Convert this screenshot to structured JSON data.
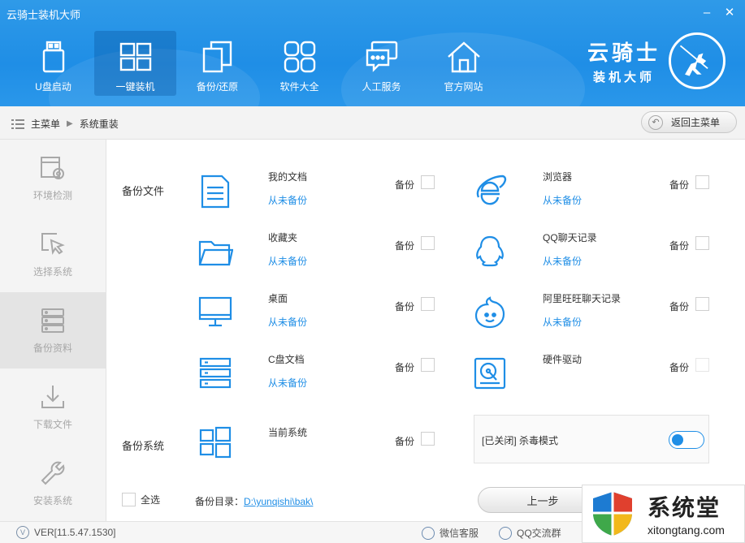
{
  "app": {
    "title": "云骑士装机大师"
  },
  "window": {
    "minimize": "–",
    "close": "✕"
  },
  "nav": [
    {
      "label": "U盘启动",
      "icon": "usb-drive-icon"
    },
    {
      "label": "一键装机",
      "icon": "windows-logo-icon",
      "active": true
    },
    {
      "label": "备份/还原",
      "icon": "backup-restore-icon"
    },
    {
      "label": "软件大全",
      "icon": "apps-grid-icon"
    },
    {
      "label": "人工服务",
      "icon": "chat-bubble-icon"
    },
    {
      "label": "官方网站",
      "icon": "home-icon"
    }
  ],
  "brand": {
    "line1": "云骑士",
    "line2": "装机大师"
  },
  "breadcrumb": {
    "root": "主菜单",
    "current": "系统重装"
  },
  "back_button": {
    "label": "返回主菜单"
  },
  "sidebar": [
    {
      "label": "环境检测",
      "icon": "environment-check-icon"
    },
    {
      "label": "选择系统",
      "icon": "cursor-select-icon"
    },
    {
      "label": "备份资料",
      "icon": "database-backup-icon",
      "active": true
    },
    {
      "label": "下载文件",
      "icon": "download-icon"
    },
    {
      "label": "安装系统",
      "icon": "wrench-icon"
    }
  ],
  "backup_files": {
    "section_label": "备份文件",
    "backup_label": "备份",
    "items": [
      {
        "name": "我的文档",
        "status": "从未备份",
        "icon": "document-icon"
      },
      {
        "name": "浏览器",
        "status": "从未备份",
        "icon": "ie-browser-icon"
      },
      {
        "name": "收藏夹",
        "status": "从未备份",
        "icon": "folder-icon"
      },
      {
        "name": "QQ聊天记录",
        "status": "从未备份",
        "icon": "qq-penguin-icon"
      },
      {
        "name": "桌面",
        "status": "从未备份",
        "icon": "monitor-icon"
      },
      {
        "name": "阿里旺旺聊天记录",
        "status": "从未备份",
        "icon": "aliwangwang-icon"
      },
      {
        "name": "C盘文档",
        "status": "从未备份",
        "icon": "server-icon"
      },
      {
        "name": "硬件驱动",
        "status": "",
        "icon": "hard-disk-icon"
      }
    ]
  },
  "backup_system": {
    "section_label": "备份系统",
    "item": {
      "name": "当前系统",
      "icon": "windows-logo-icon"
    },
    "backup_label": "备份"
  },
  "antivirus": {
    "label": "[已关闭] 杀毒模式"
  },
  "select_all": {
    "label": "全选"
  },
  "backup_dir": {
    "label": "备份目录：",
    "path": "D:\\yunqishi\\bak\\"
  },
  "prev_button": {
    "label": "上一步"
  },
  "footer": {
    "version": "VER[11.5.47.1530]",
    "wechat": "微信客服",
    "qq_group": "QQ交流群"
  },
  "watermark": {
    "cn": "系统堂",
    "en": "xitongtang.com"
  },
  "colors": {
    "accent": "#1f8ee6",
    "header": "#2a97ea"
  }
}
